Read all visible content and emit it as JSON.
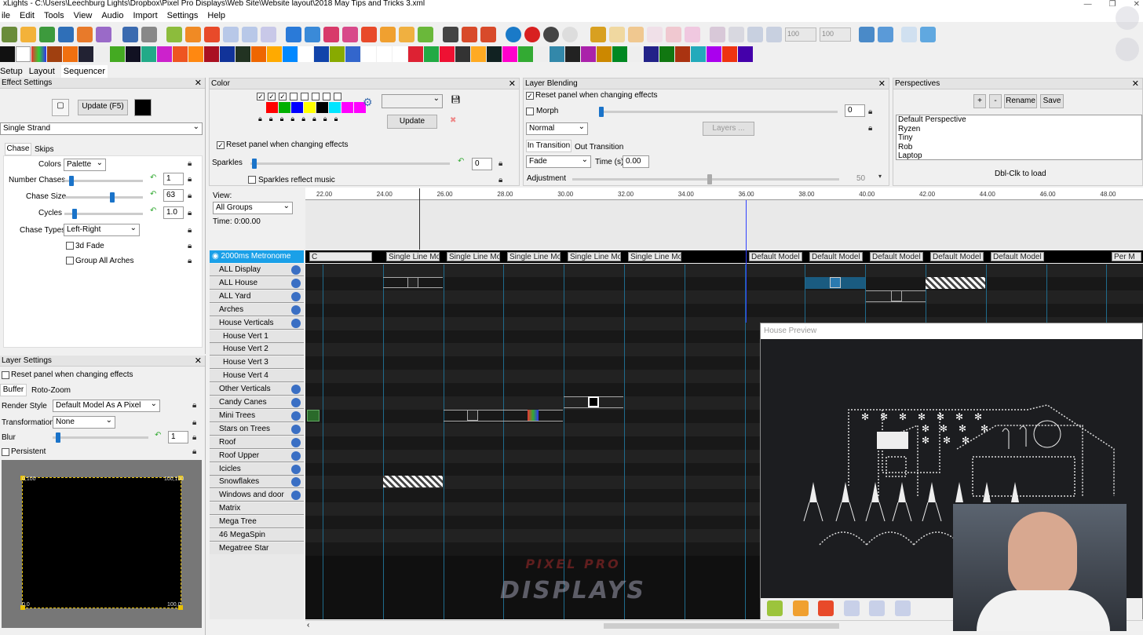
{
  "window": {
    "title": "xLights - C:\\Users\\Leechburg Lights\\Dropbox\\Pixel Pro Displays\\Web Site\\Website layout\\2018 May Tips and Tricks 3.xml"
  },
  "menu": [
    "ile",
    "Edit",
    "Tools",
    "View",
    "Audio",
    "Import",
    "Settings",
    "Help"
  ],
  "toolbar": {
    "zoom1": "100",
    "zoom2": "100"
  },
  "view_tabs": [
    "Setup",
    "Layout",
    "Sequencer"
  ],
  "effect_settings": {
    "title": "Effect Settings",
    "update_label": "Update (F5)",
    "effect_name": "Single Strand",
    "tabs": [
      "Chase",
      "Skips"
    ],
    "colors_label": "Colors",
    "colors_value": "Palette",
    "num_chases_label": "Number Chases",
    "num_chases_value": "1",
    "chase_size_label": "Chase Size",
    "chase_size_value": "63",
    "cycles_label": "Cycles",
    "cycles_value": "1.0",
    "chase_types_label": "Chase Types",
    "chase_types_value": "Left-Right",
    "fade3d_label": "3d Fade",
    "group_arches_label": "Group All Arches"
  },
  "color_panel": {
    "title": "Color",
    "update_label": "Update",
    "reset_label": "Reset panel when changing effects",
    "sparkles_label": "Sparkles",
    "sparkles_value": "0",
    "sparkles_music_label": "Sparkles reflect music",
    "swatches": [
      "#ff0000",
      "#00b000",
      "#0000ff",
      "#ffff00",
      "#000000",
      "#00e5ff",
      "#ff00ff",
      "#ff00ff"
    ]
  },
  "layer_blending": {
    "title": "Layer Blending",
    "reset_label": "Reset panel when changing effects",
    "morph_label": "Morph",
    "morph_value": "0",
    "mode_value": "Normal",
    "layers_button": "Layers ...",
    "tabs": [
      "In Transition",
      "Out Transition"
    ],
    "transition_value": "Fade",
    "time_label": "Time (s)",
    "time_value": "0.00",
    "adjustment_label": "Adjustment",
    "adjustment_value": "50"
  },
  "perspectives": {
    "title": "Perspectives",
    "add": "+",
    "remove": "-",
    "rename": "Rename",
    "save": "Save",
    "items": [
      "Default Perspective",
      "Ryzen",
      "Tiny",
      "Rob",
      "Laptop"
    ],
    "hint": "Dbl-Clk to load"
  },
  "timeline": {
    "view_label": "View:",
    "view_value": "All Groups",
    "time_label": "Time: 0:00.00",
    "ticks": [
      "22.00",
      "24.00",
      "26.00",
      "28.00",
      "30.00",
      "32.00",
      "34.00",
      "36.00",
      "38.00",
      "40.00",
      "42.00",
      "44.00",
      "46.00",
      "48.00"
    ]
  },
  "metronome": {
    "label": "2000ms Metronome",
    "effects": [
      "C",
      "Single Line Mo",
      "Single Line Mo",
      "Single Line Mo",
      "Single Line Mo",
      "Single Line Mo",
      "Default Model",
      "Default Model",
      "Default Model",
      "Default Model",
      "Default Model",
      "Per M"
    ]
  },
  "models": [
    "ALL Display",
    "ALL House",
    "ALL Yard",
    "Arches",
    "House Verticals",
    "House Vert 1",
    "House Vert 2",
    "House Vert 3",
    "House Vert 4",
    "Other Verticals",
    "Candy Canes",
    "Mini Trees",
    "Stars on Trees",
    "Roof",
    "Roof Upper",
    "Icicles",
    "Snowflakes",
    "Windows and door",
    "Matrix",
    "Mega Tree",
    "46 MegaSpin",
    "Megatree Star"
  ],
  "layer_settings": {
    "title": "Layer Settings",
    "reset_label": "Reset panel when changing effects",
    "tabs": [
      "Buffer",
      "Roto-Zoom"
    ],
    "render_style_label": "Render Style",
    "render_style_value": "Default Model As A Pixel",
    "transformation_label": "Transformation",
    "transformation_value": "None",
    "blur_label": "Blur",
    "blur_value": "1",
    "persistent_label": "Persistent",
    "corners": [
      "0,100",
      "100,100",
      "0,0",
      "100,0"
    ]
  },
  "preview": {
    "title": "House Preview"
  },
  "watermark": {
    "line1": "PIXEL PRO",
    "line2": "DISPLAYS"
  }
}
